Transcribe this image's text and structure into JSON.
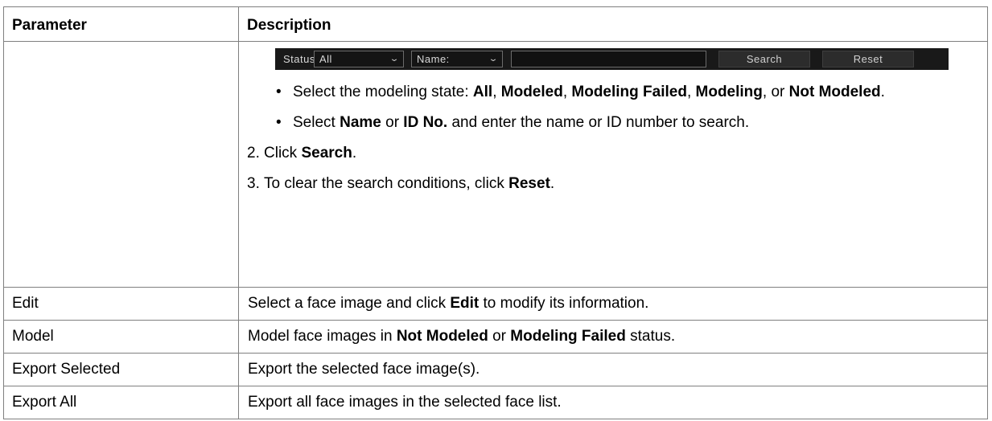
{
  "table": {
    "headers": [
      "Parameter",
      "Description"
    ],
    "search_bar": {
      "status_label": "Status",
      "status_value": "All",
      "name_value": "Name:",
      "search_button": "Search",
      "reset_button": "Reset"
    },
    "search_desc": {
      "b1_pre": "Select the modeling state: ",
      "b1_all": "All",
      "b1_sep1": ", ",
      "b1_modeled": "Modeled",
      "b1_sep2": ", ",
      "b1_failed": "Modeling Failed",
      "b1_sep3": ", ",
      "b1_modeling": "Modeling",
      "b1_or": ", or ",
      "b1_not": "Not Modeled",
      "b1_end": ".",
      "b2_pre": "Select ",
      "b2_name": "Name",
      "b2_or": " or ",
      "b2_id": "ID No.",
      "b2_post": " and enter the name or ID number to search.",
      "s2_num": "2.",
      "s2_pre": "Click ",
      "s2_bold": "Search",
      "s2_end": ".",
      "s3_num": "3.",
      "s3_pre": "To clear the search conditions, click ",
      "s3_bold": "Reset",
      "s3_end": "."
    },
    "rows": [
      {
        "param": "Edit",
        "d_pre": "Select a face image and click ",
        "d_bold": "Edit",
        "d_post": " to modify its information."
      },
      {
        "param": "Model",
        "d_pre": "Model face images in ",
        "d_bold": "Not Modeled",
        "d_mid": " or ",
        "d_bold2": "Modeling Failed",
        "d_post": " status."
      },
      {
        "param": "Export Selected",
        "d_pre": "Export the selected face image(s)."
      },
      {
        "param": "Export All",
        "d_pre": "Export all face images in the selected face list."
      }
    ]
  }
}
